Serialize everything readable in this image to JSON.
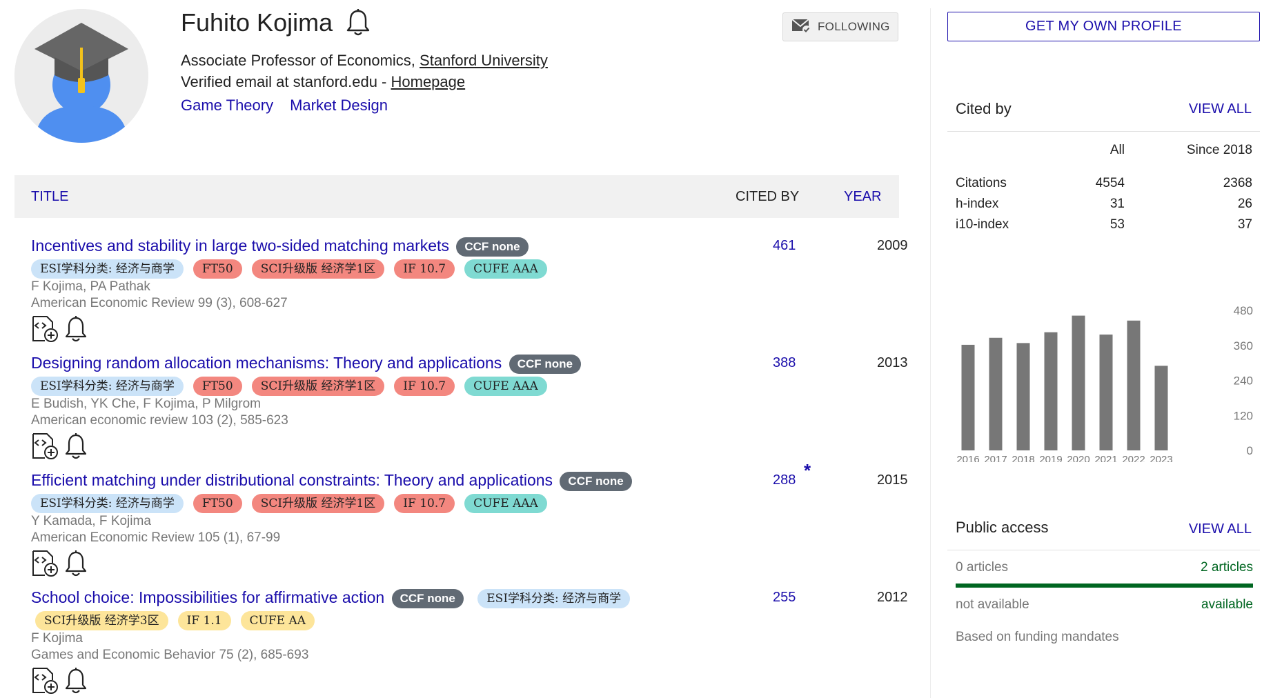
{
  "profile": {
    "name": "Fuhito Kojima",
    "affiliation_prefix": "Associate Professor of Economics, ",
    "affiliation_link": "Stanford University",
    "email_prefix": "Verified email at stanford.edu - ",
    "homepage_link": "Homepage",
    "interests": [
      "Game Theory",
      "Market Design"
    ],
    "follow_label": "FOLLOWING"
  },
  "table_header": {
    "title": "TITLE",
    "cited_by": "CITED BY",
    "year": "YEAR"
  },
  "articles": [
    {
      "title": "Incentives and stability in large two-sided matching markets",
      "ccf": "CCF none",
      "tags": [
        "ESI学科分类: 经济与商学",
        "FT50",
        "SCI升级版 经济学1区",
        "IF 10.7",
        "CUFE AAA"
      ],
      "authors": "F Kojima, PA Pathak",
      "venue": "American Economic Review 99 (3), 608-627",
      "cited_by": "461",
      "year": "2009"
    },
    {
      "title": "Designing random allocation mechanisms: Theory and applications",
      "ccf": "CCF none",
      "tags": [
        "ESI学科分类: 经济与商学",
        "FT50",
        "SCI升级版 经济学1区",
        "IF 10.7",
        "CUFE AAA"
      ],
      "authors": "E Budish, YK Che, F Kojima, P Milgrom",
      "venue": "American economic review 103 (2), 585-623",
      "cited_by": "388",
      "year": "2013"
    },
    {
      "title": "Efficient matching under distributional constraints: Theory and applications",
      "ccf": "CCF none",
      "tags": [
        "ESI学科分类: 经济与商学",
        "FT50",
        "SCI升级版 经济学1区",
        "IF 10.7",
        "CUFE AAA"
      ],
      "authors": "Y Kamada, F Kojima",
      "venue": "American Economic Review 105 (1), 67-99",
      "cited_by": "288",
      "star": "*",
      "year": "2015"
    },
    {
      "title": "School choice: Impossibilities for affirmative action",
      "ccf": "CCF none",
      "inline_tag": "ESI学科分类: 经济与商学",
      "tags": [
        "SCI升级版 经济学3区",
        "IF 1.1",
        "CUFE AA"
      ],
      "authors": "F Kojima",
      "venue": "Games and Economic Behavior 75 (2), 685-693",
      "cited_by": "255",
      "year": "2012"
    }
  ],
  "sidebar": {
    "own_profile_button": "GET MY OWN PROFILE",
    "cited_by": {
      "heading": "Cited by",
      "view_all": "VIEW ALL",
      "col_all": "All",
      "col_since": "Since 2018",
      "rows": [
        {
          "label": "Citations",
          "all": "4554",
          "since": "2368"
        },
        {
          "label": "h-index",
          "all": "31",
          "since": "26"
        },
        {
          "label": "i10-index",
          "all": "53",
          "since": "37"
        }
      ]
    },
    "public_access": {
      "heading": "Public access",
      "view_all": "VIEW ALL",
      "left_count": "0 articles",
      "right_count": "2 articles",
      "left_label": "not available",
      "right_label": "available",
      "note": "Based on funding mandates",
      "available_fraction": 1.0
    }
  },
  "chart_data": {
    "type": "bar",
    "categories": [
      "2016",
      "2017",
      "2018",
      "2019",
      "2020",
      "2021",
      "2022",
      "2023"
    ],
    "values": [
      362,
      386,
      368,
      405,
      462,
      397,
      445,
      290
    ],
    "yticks": [
      "480",
      "360",
      "240",
      "120",
      "0"
    ],
    "ylim": [
      0,
      480
    ],
    "bar_color": "#777777"
  },
  "colors": {
    "link": "#1a0dab",
    "ccf_badge": "#616a74",
    "esi_tag": "#cbe3f8",
    "red_tag": "#f3877f",
    "teal_tag": "#7fdad2",
    "yellow_tag": "#fde59a",
    "available_green": "#006621"
  },
  "icons": [
    "bell-icon",
    "mail-check-icon",
    "code-doc-add-icon",
    "bell-outline-icon"
  ]
}
